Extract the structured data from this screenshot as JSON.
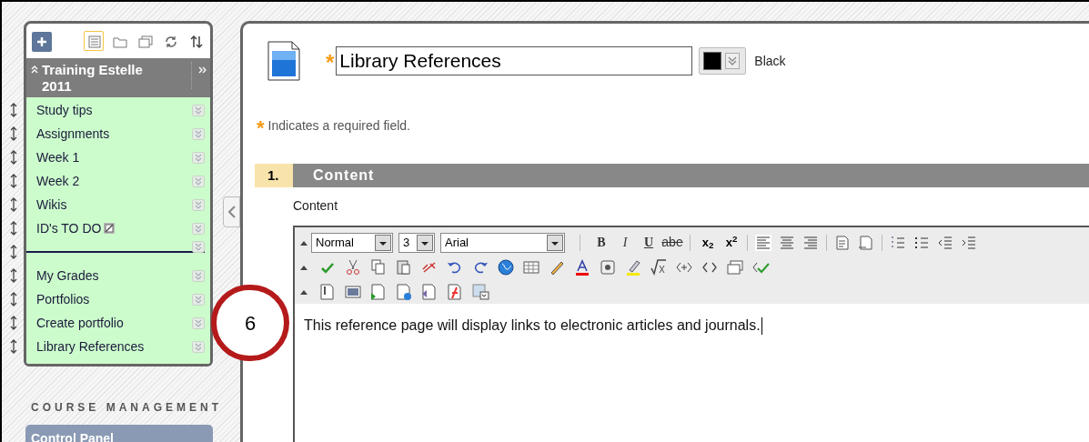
{
  "sidebar": {
    "title": "Training Estelle 2011",
    "expanded": true,
    "tools": [
      {
        "kind": "add",
        "selected": false
      },
      {
        "kind": "list",
        "selected": true
      },
      {
        "kind": "folder",
        "selected": false
      },
      {
        "kind": "windows",
        "selected": false
      },
      {
        "kind": "refresh",
        "selected": false
      },
      {
        "kind": "sort",
        "selected": false
      }
    ],
    "items": [
      {
        "kind": "link",
        "label": "Study tips",
        "hidden": false
      },
      {
        "kind": "link",
        "label": "Assignments",
        "hidden": false
      },
      {
        "kind": "link",
        "label": "Week 1",
        "hidden": false
      },
      {
        "kind": "link",
        "label": "Week 2",
        "hidden": false
      },
      {
        "kind": "link",
        "label": "Wikis",
        "hidden": false
      },
      {
        "kind": "link",
        "label": "ID's TO DO",
        "hidden": true
      },
      {
        "kind": "divider"
      },
      {
        "kind": "link",
        "label": "My Grades",
        "hidden": false
      },
      {
        "kind": "link",
        "label": "Portfolios",
        "hidden": false
      },
      {
        "kind": "link",
        "label": "Create portfolio",
        "hidden": false
      },
      {
        "kind": "link",
        "label": "Library References",
        "hidden": false
      }
    ],
    "management_heading": "COURSE MANAGEMENT",
    "control_panel": "Control Panel"
  },
  "callout": "6",
  "form": {
    "required_mark": "*",
    "title_value": "Library References",
    "color_label": "Black",
    "color": "#000000",
    "required_note": "Indicates a required field.",
    "section": {
      "number": "1.",
      "title": "Content"
    },
    "field_label": "Content",
    "editor": {
      "format": "Normal",
      "size": "3",
      "font": "Arial",
      "text_buttons": [
        {
          "label": "B",
          "kind": "bold"
        },
        {
          "label": "I",
          "kind": "italic"
        },
        {
          "label": "U",
          "kind": "underline"
        },
        {
          "label": "abe",
          "kind": "strike"
        }
      ],
      "script_buttons": [
        "x$_{2}$",
        "x$^{2}$"
      ],
      "body": "This reference page will display links to electronic articles and journals."
    }
  }
}
